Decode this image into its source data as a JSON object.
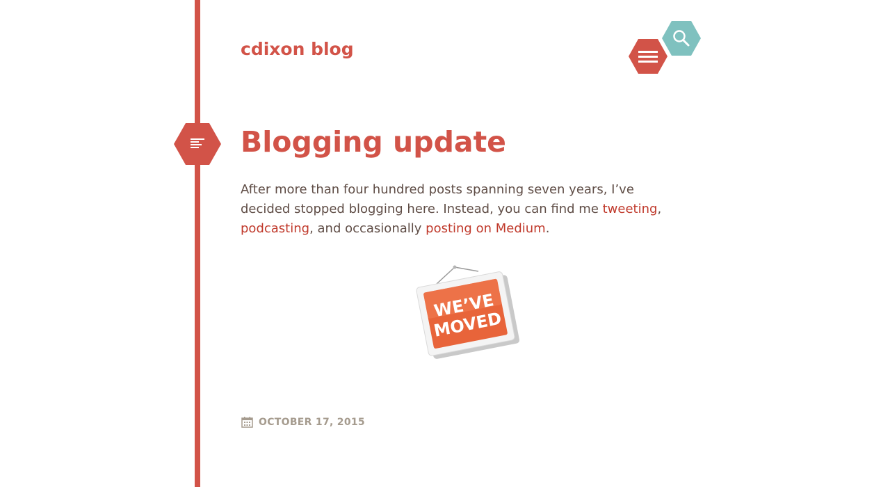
{
  "site": {
    "title": "cdixon blog"
  },
  "header": {
    "search_icon": "search-icon",
    "menu_icon": "hamburger-menu-icon"
  },
  "colors": {
    "accent": "#d25348",
    "teal": "#7fc1bf",
    "text": "#5f4d46",
    "meta": "#a59b8e",
    "link": "#c0392b"
  },
  "post": {
    "format_icon": "text-lines-icon",
    "title": "Blogging update",
    "body_part1": "After more than four hundred posts spanning seven years, I’ve decided stopped blogging here. Instead, you can find me ",
    "link_tweeting": "tweeting",
    "sep1": ", ",
    "link_podcasting": "podcasting",
    "body_part2": ", and occasionally ",
    "link_medium": "posting on Medium",
    "body_end": ".",
    "image_text_line1": "WE’VE",
    "image_text_line2": "MOVED",
    "date_icon": "calendar-icon",
    "date": "OCTOBER 17, 2015"
  }
}
